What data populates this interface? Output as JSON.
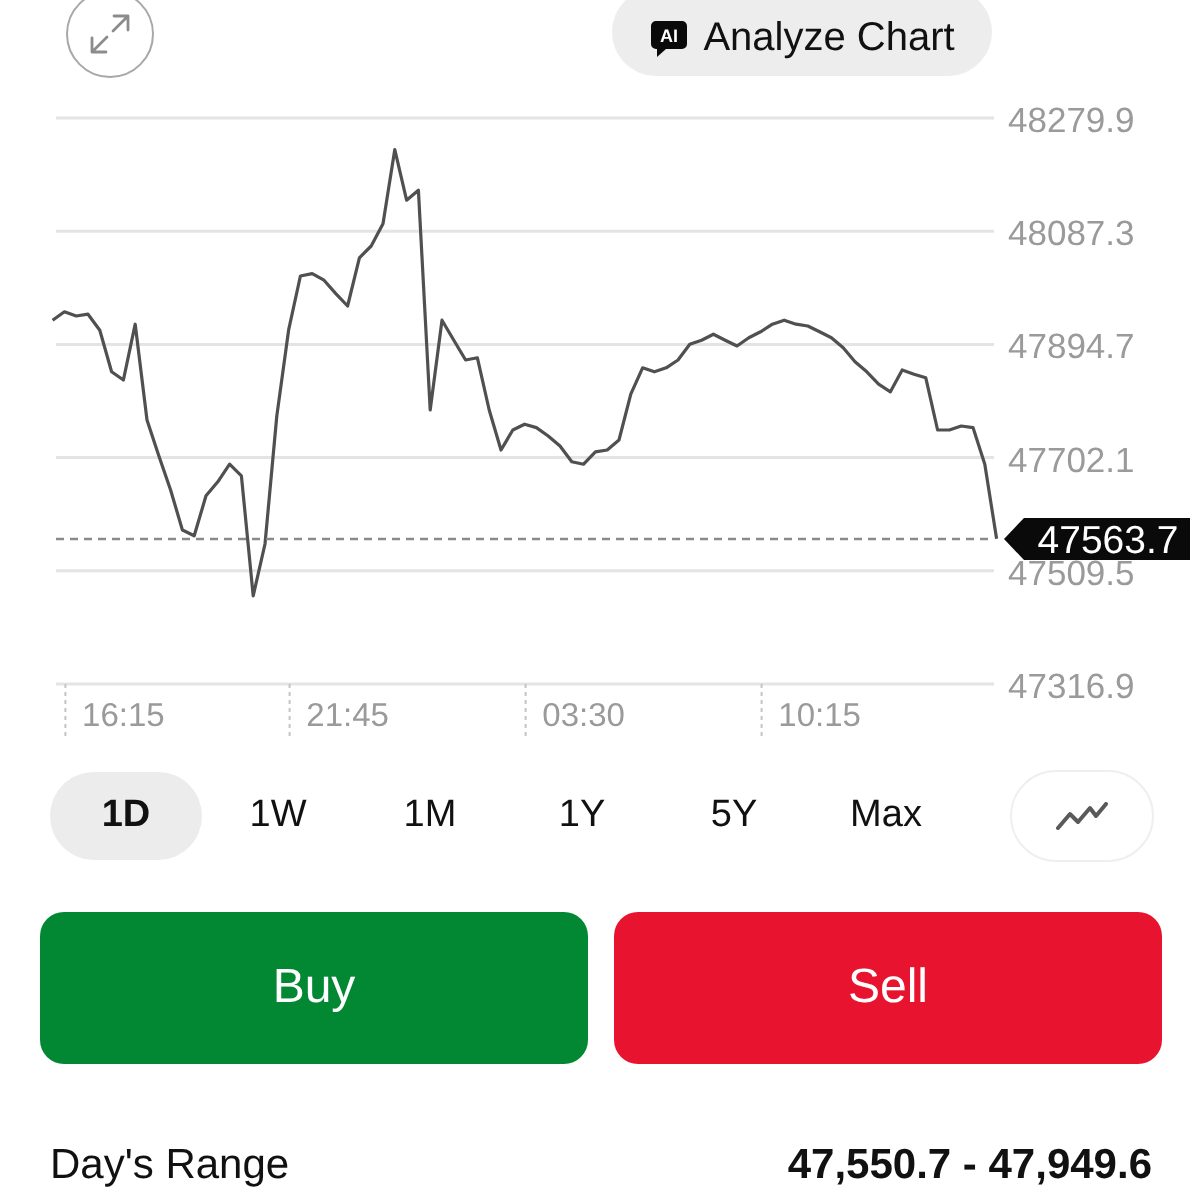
{
  "toolbar": {
    "analyze_button": {
      "label": "Analyze Chart",
      "icon_text": "AI"
    }
  },
  "chart": {
    "chart_data": {
      "type": "line",
      "categories": [
        null,
        null,
        null,
        null,
        null,
        null,
        "16:15",
        null,
        null,
        null,
        null,
        null,
        null,
        null,
        null,
        null,
        null,
        null,
        null,
        null,
        null,
        null,
        null,
        null,
        null,
        "21:45",
        null,
        null,
        null,
        null,
        null,
        null,
        null,
        null,
        null,
        null,
        null,
        null,
        null,
        null,
        null,
        null,
        null,
        null,
        null,
        "03:30",
        null,
        null,
        null,
        null,
        null,
        null,
        null,
        null,
        null,
        null,
        null,
        null,
        null,
        null,
        null,
        null,
        null,
        null,
        null,
        "10:15",
        null,
        null,
        null,
        null,
        null,
        null,
        null,
        null,
        null,
        null,
        null,
        null,
        null,
        null,
        null
      ],
      "series": [
        {
          "color": "#505050",
          "values": [
            47936,
            47950,
            47943,
            47946,
            47919,
            47848,
            47834,
            47929,
            47766,
            47705,
            47647,
            47579,
            47569,
            47637,
            47661,
            47691,
            47671,
            47467,
            47555,
            47773,
            47919,
            48011,
            48015,
            48004,
            47981,
            47960,
            48042,
            48062,
            48100,
            48226,
            48140,
            48157,
            47783,
            47936,
            47902,
            47868,
            47872,
            47783,
            47715,
            47749,
            47759,
            47753,
            47739,
            47722,
            47695,
            47691,
            47712,
            47715,
            47732,
            47810,
            47855,
            47848,
            47855,
            47868,
            47895,
            47902,
            47912,
            47902,
            47892,
            47906,
            47916,
            47929,
            47936,
            47929,
            47926,
            47916,
            47906,
            47889,
            47865,
            47848,
            47827,
            47814,
            47851,
            47844,
            47838,
            47749,
            47749,
            47756,
            47753,
            47691,
            47564
          ]
        }
      ],
      "ylim": [
        47316.9,
        48279.9
      ],
      "yticks": [
        48279.9,
        48087.3,
        47894.7,
        47702.1,
        47509.5,
        47316.9
      ],
      "grid": true,
      "ref_lines": [
        {
          "axis": "y",
          "value": 47563.7,
          "label": "47563.7"
        }
      ]
    }
  },
  "periods": [
    {
      "label": "1D",
      "selected": true
    },
    {
      "label": "1W",
      "selected": false
    },
    {
      "label": "1M",
      "selected": false
    },
    {
      "label": "1Y",
      "selected": false
    },
    {
      "label": "5Y",
      "selected": false
    },
    {
      "label": "Max",
      "selected": false
    }
  ],
  "actions": [
    {
      "label": "Buy",
      "kind": "buy"
    },
    {
      "label": "Sell",
      "kind": "sell"
    }
  ],
  "stats": [
    {
      "label": "Day's Range",
      "value": "47,550.7 - 47,949.6"
    }
  ]
}
